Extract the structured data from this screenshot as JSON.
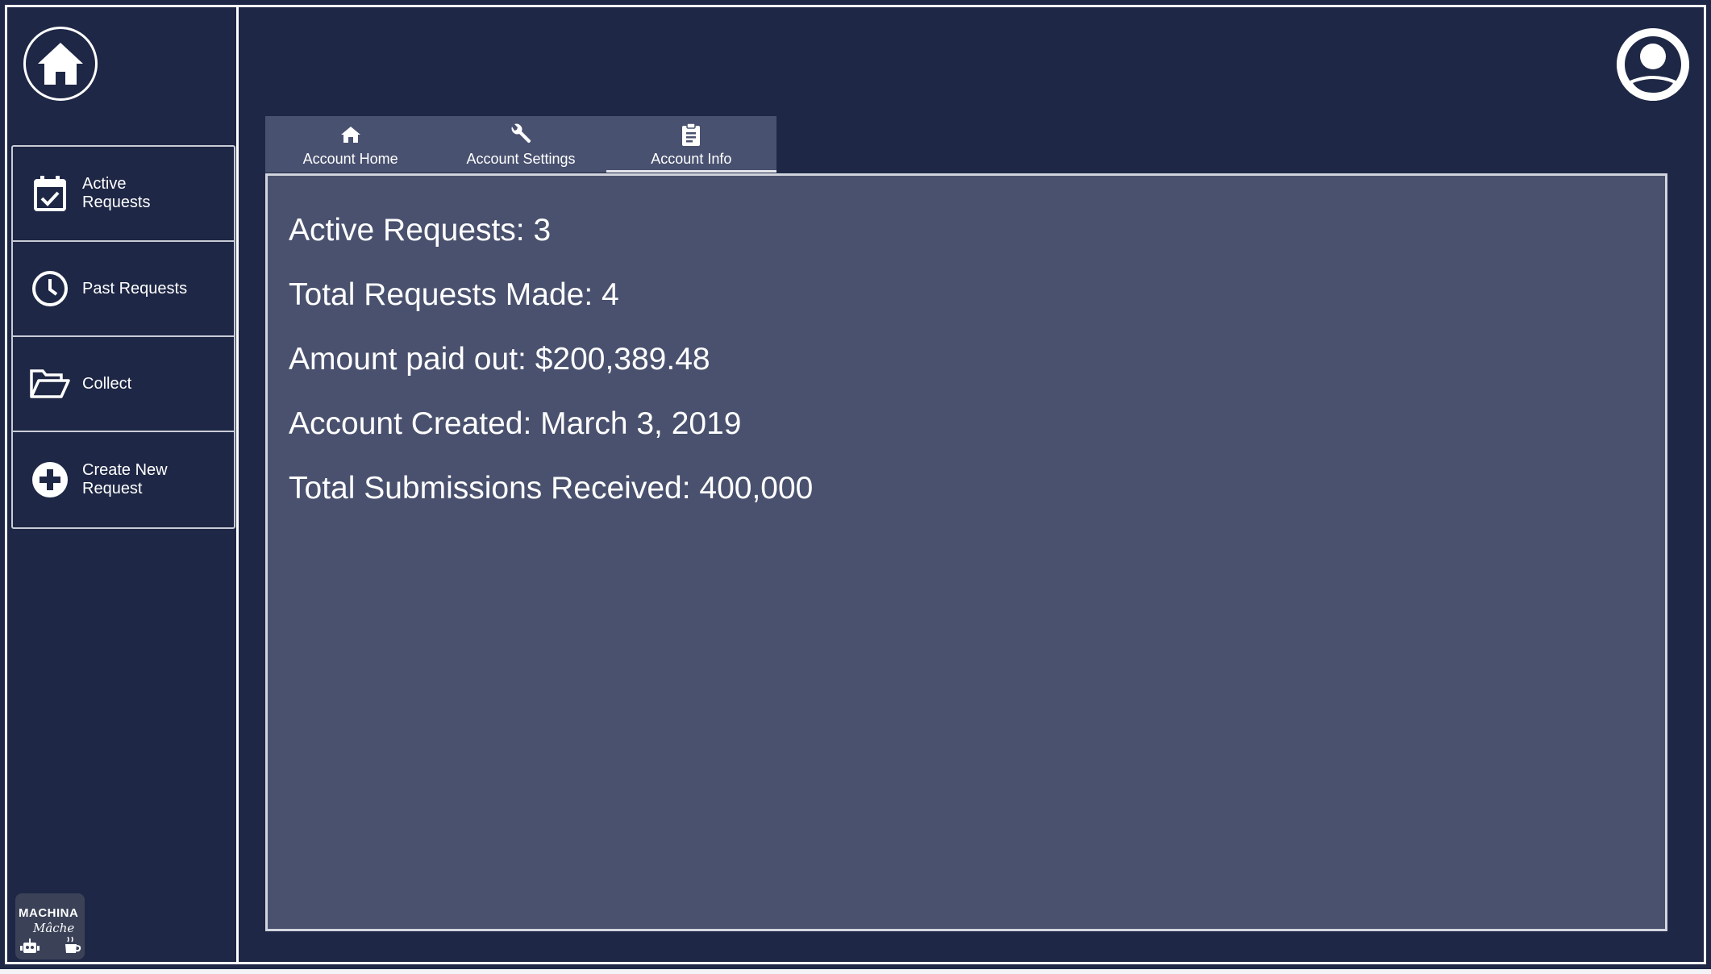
{
  "sidebar": {
    "home_icon": "home-icon",
    "items": [
      {
        "label": "Active Requests",
        "icon": "calendar-check-icon"
      },
      {
        "label": "Past Requests",
        "icon": "clock-icon"
      },
      {
        "label": "Collect",
        "icon": "folder-open-icon"
      },
      {
        "label": "Create New Request",
        "icon": "plus-circle-icon"
      }
    ],
    "logo": {
      "line1": "MACHINA",
      "line2": "Mâche"
    }
  },
  "header": {
    "avatar_icon": "user-avatar-icon"
  },
  "tabs": [
    {
      "label": "Account Home",
      "icon": "home-icon",
      "active": false
    },
    {
      "label": "Account Settings",
      "icon": "wrench-icon",
      "active": false
    },
    {
      "label": "Account Info",
      "icon": "clipboard-icon",
      "active": true
    }
  ],
  "account_info": {
    "active_requests": "Active Requests: 3",
    "total_requests": "Total Requests Made: 4",
    "amount_paid": "Amount paid out: $200,389.48",
    "account_created": "Account Created: March 3, 2019",
    "total_submissions": "Total Submissions Received: 400,000"
  },
  "colors": {
    "background": "#1e2745",
    "panel": "#49516e",
    "tabs": "#495170",
    "text": "#ffffff"
  }
}
